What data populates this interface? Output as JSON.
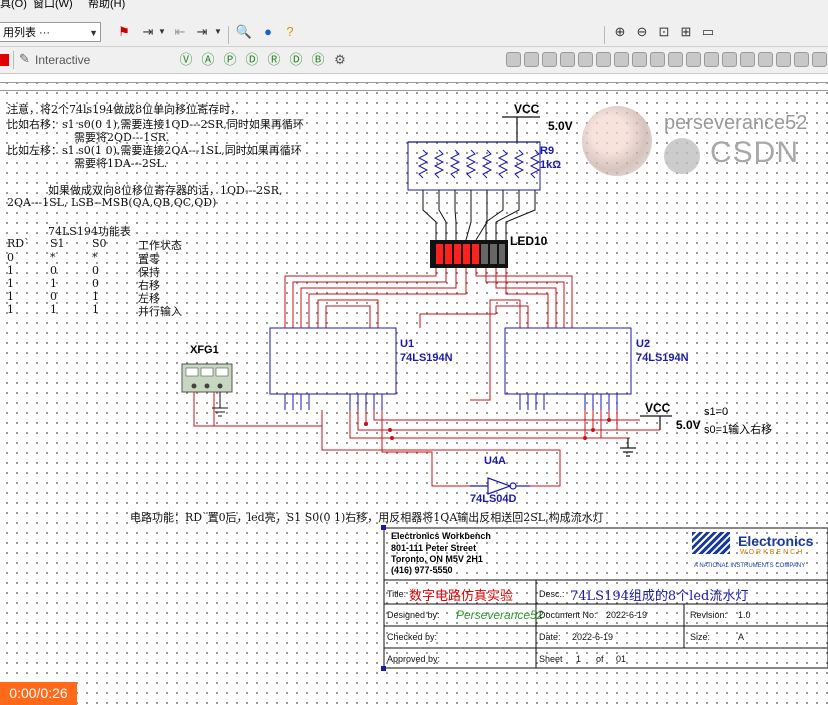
{
  "menubar": {
    "items": [
      "具(O)",
      "窗口(W)",
      "帮助(H)"
    ]
  },
  "toolbar": {
    "list_select_value": "用列表 ···",
    "interactive_label": "Interactive"
  },
  "notes": {
    "line1": "注意，将2个74ls194做成8位单向移位寄存时，",
    "line2": "比如右移：s1 s0(0 1),需要连接1QD---2SR,同时如果再循环",
    "line3": "需要将2QD---1SR.",
    "line4": "比如左移：s1 s0(1 0),需要连接2QA---1SL,同时如果再循环",
    "line5": "需要将1DA---2SL.",
    "line6": "如果做成双向8位移位寄存器的话，1QD---2SR,",
    "line7": "2QA---1SL, LSB--MSB(QA,QB,QC,QD)"
  },
  "function_table": {
    "title": "74LS194功能表",
    "headers": [
      "RD`",
      "S1",
      "S0",
      "工作状态"
    ],
    "rows": [
      [
        "0",
        "*",
        "*",
        "置零"
      ],
      [
        "1",
        "0",
        "0",
        "保持"
      ],
      [
        "1",
        "1",
        "0",
        "右移"
      ],
      [
        "1",
        "0",
        "1",
        "左移"
      ],
      [
        "1",
        "1",
        "1",
        "并行输入"
      ]
    ]
  },
  "components": {
    "vcc_top": "VCC",
    "vcc_top_voltage": "5.0V",
    "resistor_ref": "R9",
    "resistor_value": "1kΩ",
    "led_ref": "LED10",
    "u1_ref": "U1",
    "u1_part": "74LS194N",
    "u2_ref": "U2",
    "u2_part": "74LS194N",
    "xfg": "XFG1",
    "vcc_right": "VCC",
    "vcc_right_voltage": "5.0V",
    "u4a_ref": "U4A",
    "u4a_part": "74LS04D",
    "s1_note": "s1=0",
    "s0_note": "s0=1输入右移"
  },
  "circuit_description": "电路功能：RD`置0后，led亮，S1 S0(0 1)右移，用反相器将1QA输出反相送回2SL,构成流水灯",
  "title_block": {
    "company": "Electronics Workbench",
    "address1": "801-111 Peter Street",
    "address2": "Toronto, ON M5V 2H1",
    "phone": "(416) 977-5550",
    "logo_text": "Electronics",
    "logo_sub": "WORKBENCH",
    "logo_tag": "A NATIONAL INSTRUMENTS COMPANY",
    "title_label": "Title:",
    "title_value": "数字电路仿真实验",
    "desc_label": "Desc.:",
    "desc_value": "74LS194组成的8个led流水灯",
    "designed_label": "Designed by:",
    "designed_value": "Perseverance52",
    "docno_label": "Document No:",
    "docno_value": "2022-6-19",
    "revision_label": "Revision:",
    "revision_value": "1.0",
    "checked_label": "Checked by:",
    "date_label": "Date:",
    "date_value": "2022-6-19",
    "size_label": "Size:",
    "size_value": "A",
    "approved_label": "Approved by:",
    "sheet_label": "Sheet",
    "sheet_value": "1",
    "of_label": "of",
    "of_value": "01"
  },
  "watermark": {
    "name": "perseverance52",
    "site": "CSDN"
  },
  "playback": {
    "time": "0:00/0:26"
  },
  "colors": {
    "wire": "#c8101a",
    "chip": "#1a1aa8",
    "accent_orange": "#ff6a1a",
    "title_red": "#e00000"
  }
}
